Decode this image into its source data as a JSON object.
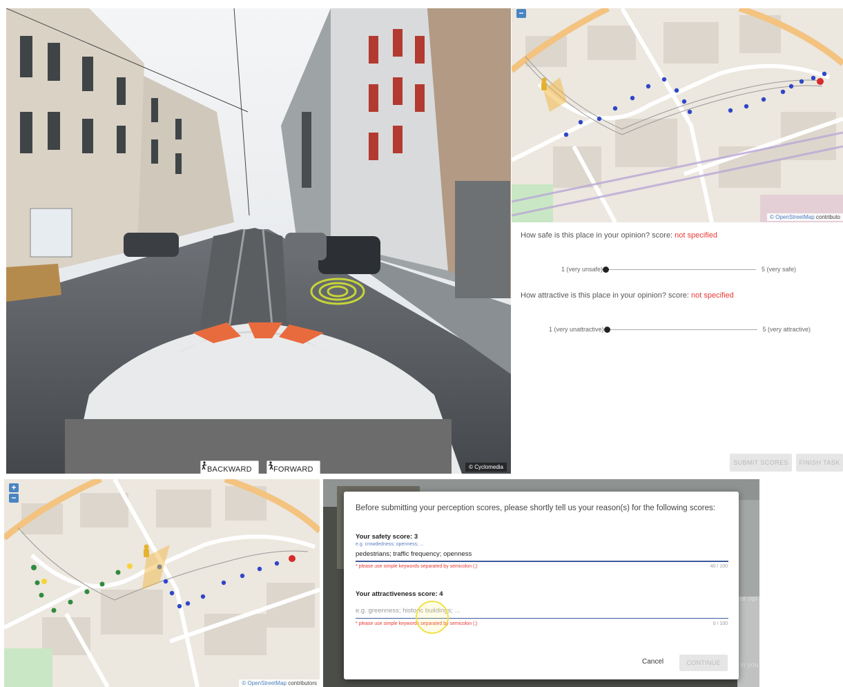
{
  "street_view": {
    "backward_label": "BACKWARD",
    "forward_label": "FORWARD",
    "credit": "© Cyclomedia"
  },
  "map_top": {
    "zoom_out": "−",
    "attribution_link": "© OpenStreetMap",
    "attribution_rest": " contributo"
  },
  "map_bottom": {
    "zoom_in": "+",
    "zoom_out": "−",
    "attribution_link": "© OpenStreetMap",
    "attribution_rest": " contributors"
  },
  "survey": {
    "safety_question": "How safe is this place in your opinion? score: ",
    "safety_status": "not specified",
    "safety_min": "1 (very unsafe)",
    "safety_max": "5 (very safe)",
    "attract_question": "How attractive is this place in your opinion? score: ",
    "attract_status": "not specified",
    "attract_min": "1 (very unattractive)",
    "attract_max": "5 (very attractive)",
    "submit_label": "SUBMIT SCORES",
    "finish_label": "FINISH TASK",
    "status_color": "#e53935"
  },
  "dialog": {
    "intro": "Before submitting your perception scores, please shortly tell us your reason(s) for the following scores:",
    "safety_label": "Your safety score: 3",
    "safety_hint": "e.g. crowdedness; openness; ...",
    "safety_value": "pedestrians; traffic frequency; openness",
    "safety_warning": "* please use simple keywords separated by semicolon (;)",
    "safety_count": "40 / 100",
    "attract_label": "Your attractiveness score: 4",
    "attract_placeholder": "e.g. greenness; historic buildings; ...",
    "attract_warning": "* please use simple keywords separated by semicolon (;)",
    "attract_count": "0 / 100",
    "cancel_label": "Cancel",
    "continue_label": "CONTINUE"
  },
  "behind_dialog": {
    "fragment_1": "ur opi",
    "fragment_2": "in you"
  }
}
